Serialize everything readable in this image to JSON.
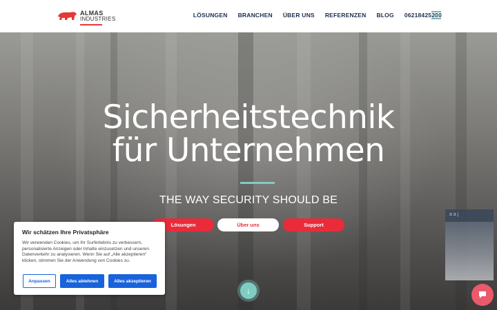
{
  "header": {
    "logo": {
      "top": "ALMAS",
      "bottom": "INDUSTRIES"
    },
    "nav": [
      "LÖSUNGEN",
      "BRANCHEN",
      "ÜBER UNS",
      "REFERENZEN",
      "BLOG",
      "06218425280"
    ]
  },
  "hero": {
    "title_line1": "Sicherheitstechnik",
    "title_line2": "für Unternehmen",
    "subtitle": "THE WAY SECURITY SHOULD BE",
    "buttons": [
      "Lösungen",
      "Über uns",
      "Support"
    ],
    "side_text": "a  a  j"
  },
  "cookie": {
    "title": "Wir schätzen Ihre Privatsphäre",
    "text": "Wir verwenden Cookies, um Ihr Surferlebnis zu verbessern, personalisierte Anzeigen oder Inhalte einzusetzen und unseren Datenverkehr zu analysieren. Wenn Sie auf „Alle akzeptieren“ klicken, stimmen Sie der Anwendung von Cookies zu.",
    "btn_customize": "Anpassen",
    "btn_reject": "Alles ablehnen",
    "btn_accept": "Alles akzeptieren"
  },
  "colors": {
    "accent_red": "#ea2b3a",
    "accent_teal": "#7fcdc2",
    "cookie_blue": "#1863dc",
    "nav_text": "#1d2d50"
  },
  "icons": {
    "scroll": "arrow-down-icon",
    "chat": "chat-bubble-icon",
    "menu": "hamburger-icon",
    "logo": "bear-logo-icon"
  }
}
